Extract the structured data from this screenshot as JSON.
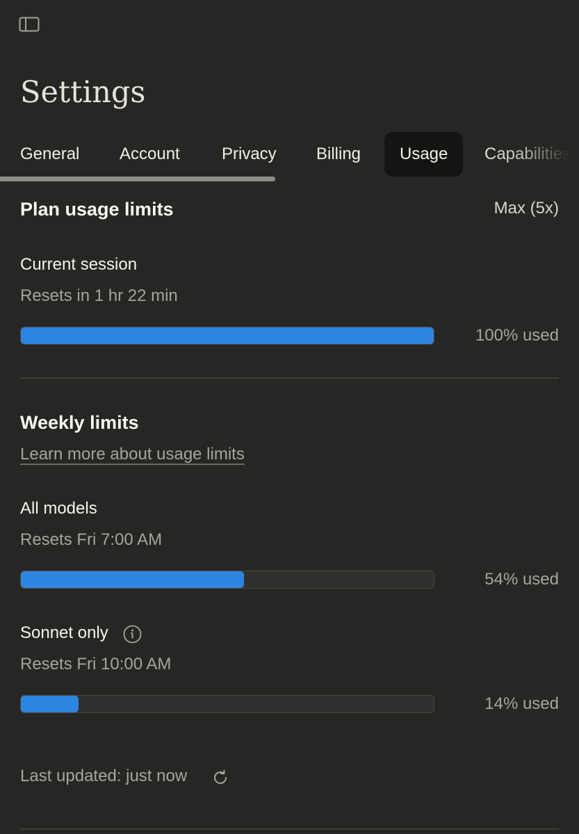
{
  "header": {
    "title": "Settings",
    "sidebar_icon": "sidebar-toggle-icon"
  },
  "tabs": [
    {
      "label": "General",
      "active": false
    },
    {
      "label": "Account",
      "active": false
    },
    {
      "label": "Privacy",
      "active": false
    },
    {
      "label": "Billing",
      "active": false
    },
    {
      "label": "Usage",
      "active": true
    },
    {
      "label": "Capabilities",
      "active": false
    }
  ],
  "plan": {
    "title": "Plan usage limits",
    "badge": "Max (5x)"
  },
  "current_session": {
    "label": "Current session",
    "reset": "Resets in 1 hr 22 min",
    "percent": 100,
    "used_text": "100% used"
  },
  "weekly": {
    "title": "Weekly limits",
    "link": "Learn more about usage limits",
    "all_models": {
      "label": "All models",
      "reset": "Resets Fri 7:00 AM",
      "percent": 54,
      "used_text": "54% used"
    },
    "sonnet": {
      "label": "Sonnet only",
      "info_icon": "info-icon",
      "reset": "Resets Fri 10:00 AM",
      "percent": 14,
      "used_text": "14% used"
    }
  },
  "footer": {
    "updated": "Last updated: just now",
    "refresh_icon": "refresh-icon"
  },
  "colors": {
    "background": "#262624",
    "bar_fill": "#2e85e0",
    "active_tab": "#141413"
  }
}
